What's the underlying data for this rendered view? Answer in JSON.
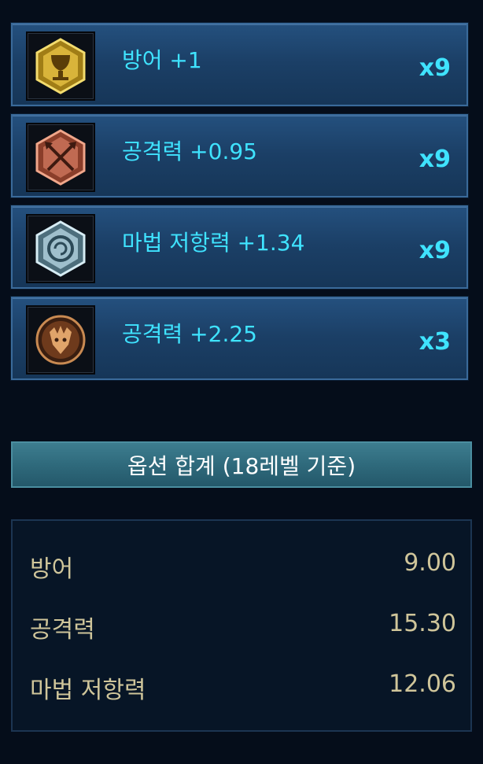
{
  "runes": [
    {
      "icon": "chalice-rune-icon",
      "label": "방어 +1",
      "count": "x9",
      "tier_color": "#d6b73a"
    },
    {
      "icon": "crossed-arrows-rune-icon",
      "label": "공격력 +0.95",
      "count": "x9",
      "tier_color": "#c06a52"
    },
    {
      "icon": "shell-rune-icon",
      "label": "마법 저항력 +1.34",
      "count": "x9",
      "tier_color": "#9fbfcc"
    },
    {
      "icon": "dragon-rune-icon",
      "label": "공격력 +2.25",
      "count": "x3",
      "tier_color": "#b0683a"
    }
  ],
  "summary": {
    "title": "옵션 합계 (18레벨 기준)",
    "totals": [
      {
        "name": "방어",
        "value": "9.00"
      },
      {
        "name": "공격력",
        "value": "15.30"
      },
      {
        "name": "마법 저항력",
        "value": "12.06"
      }
    ]
  },
  "colors": {
    "label": "#3fe3ff",
    "total_text": "#cfc59a",
    "background": "#050d1a"
  }
}
